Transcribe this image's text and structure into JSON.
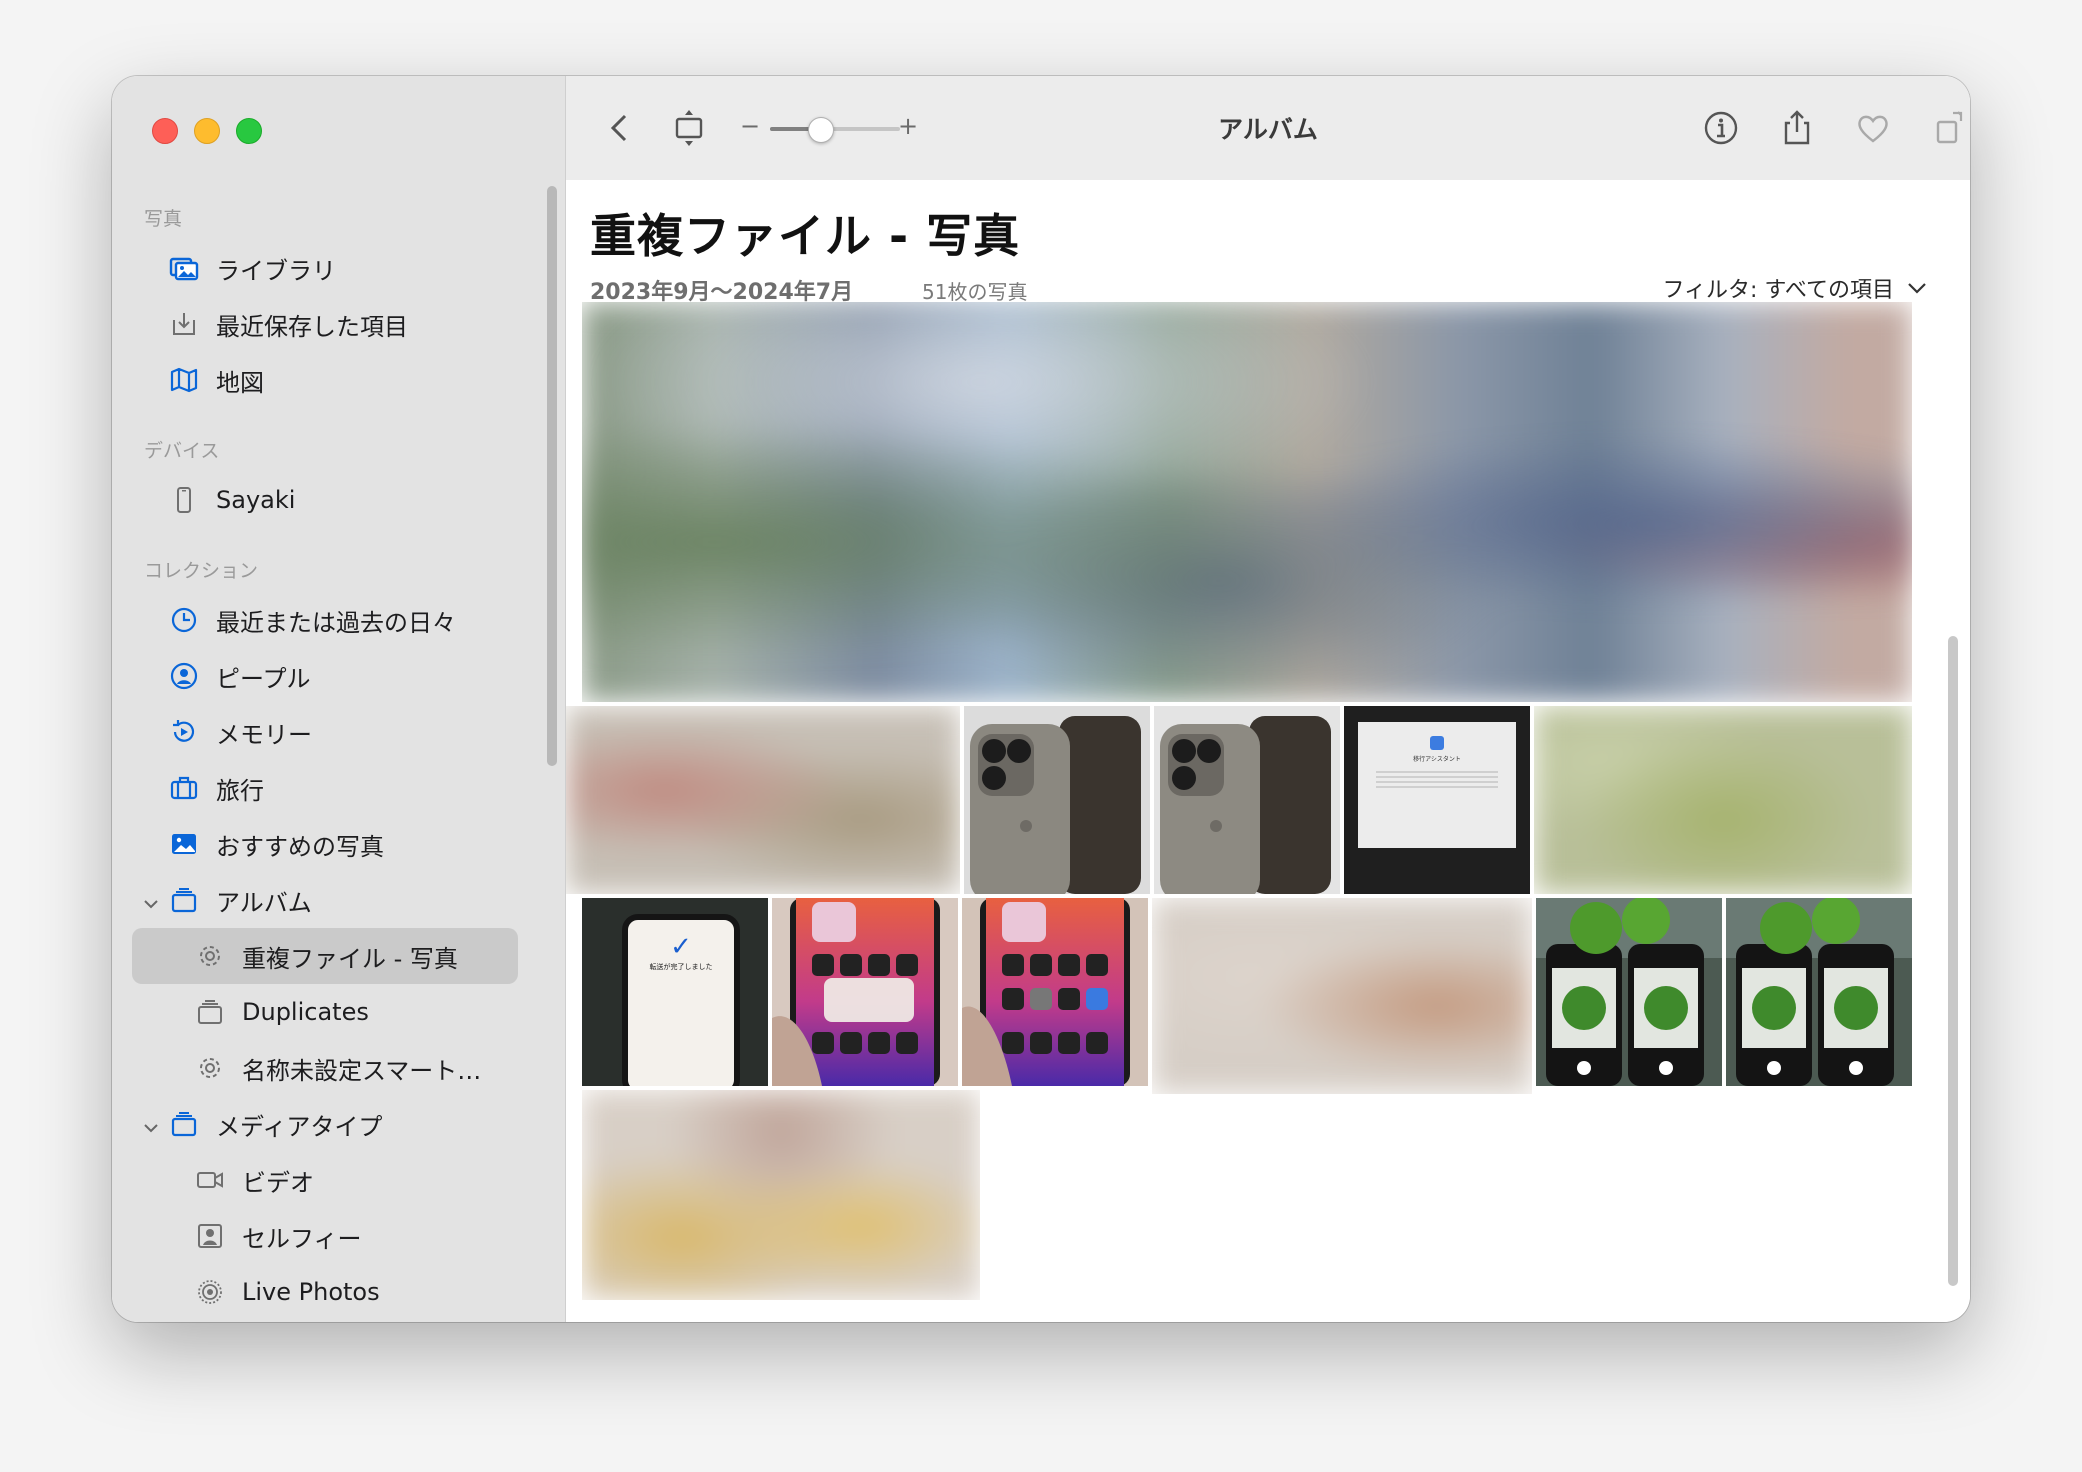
{
  "sidebar": {
    "sections": [
      {
        "label": "写真"
      },
      {
        "label": "デバイス"
      },
      {
        "label": "コレクション"
      }
    ],
    "items": [
      {
        "label": "ライブラリ"
      },
      {
        "label": "最近保存した項目"
      },
      {
        "label": "地図"
      },
      {
        "label": "Sayaki"
      },
      {
        "label": "最近または過去の日々"
      },
      {
        "label": "ピープル"
      },
      {
        "label": "メモリー"
      },
      {
        "label": "旅行"
      },
      {
        "label": "おすすめの写真"
      },
      {
        "label": "アルバム"
      },
      {
        "label": "重複ファイル - 写真"
      },
      {
        "label": "Duplicates"
      },
      {
        "label": "名称未設定スマート…"
      },
      {
        "label": "メディアタイプ"
      },
      {
        "label": "ビデオ"
      },
      {
        "label": "セルフィー"
      },
      {
        "label": "Live Photos"
      }
    ]
  },
  "toolbar": {
    "title": "アルバム",
    "zoom_minus": "−",
    "zoom_plus": "+",
    "zoom_level": 0.3
  },
  "album": {
    "title": "重複ファイル - 写真",
    "date_range": "2023年9月〜2024年7月",
    "count": "51枚の写真",
    "filter": "フィルタ: すべての項目"
  },
  "screen_texts": {
    "transfer_done": "転送が完了しました",
    "migration": "移行アシスタント"
  },
  "colors": {
    "accent": "#0a66d8",
    "sidebar_bg": "#e3e3e3",
    "selected_bg": "#cacaca"
  }
}
